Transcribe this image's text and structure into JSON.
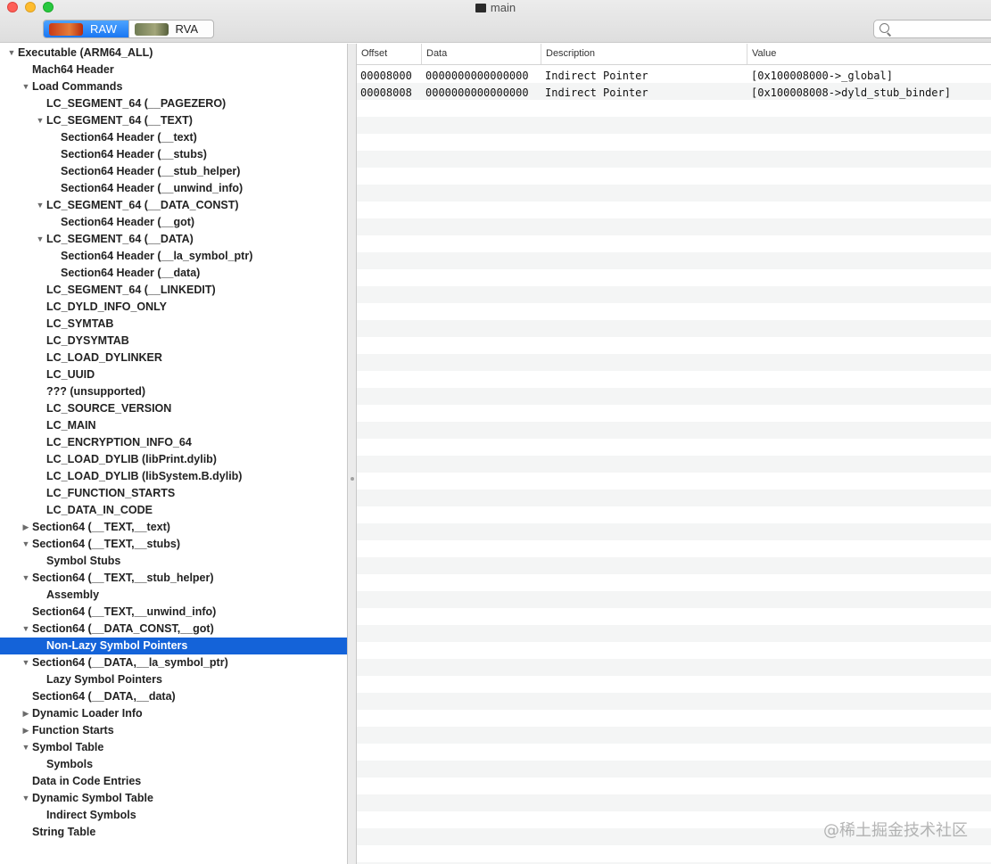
{
  "window": {
    "title": "main"
  },
  "toolbar": {
    "raw_label": "RAW",
    "rva_label": "RVA",
    "search_placeholder": ""
  },
  "tree": [
    {
      "label": "Executable  (ARM64_ALL)",
      "level": 0,
      "disclosure": "open"
    },
    {
      "label": "Mach64 Header",
      "level": 1,
      "disclosure": "none"
    },
    {
      "label": "Load Commands",
      "level": 1,
      "disclosure": "open"
    },
    {
      "label": "LC_SEGMENT_64 (__PAGEZERO)",
      "level": 2,
      "disclosure": "none"
    },
    {
      "label": "LC_SEGMENT_64 (__TEXT)",
      "level": 2,
      "disclosure": "open"
    },
    {
      "label": "Section64 Header (__text)",
      "level": 3,
      "disclosure": "none"
    },
    {
      "label": "Section64 Header (__stubs)",
      "level": 3,
      "disclosure": "none"
    },
    {
      "label": "Section64 Header (__stub_helper)",
      "level": 3,
      "disclosure": "none"
    },
    {
      "label": "Section64 Header (__unwind_info)",
      "level": 3,
      "disclosure": "none"
    },
    {
      "label": "LC_SEGMENT_64 (__DATA_CONST)",
      "level": 2,
      "disclosure": "open"
    },
    {
      "label": "Section64 Header (__got)",
      "level": 3,
      "disclosure": "none"
    },
    {
      "label": "LC_SEGMENT_64 (__DATA)",
      "level": 2,
      "disclosure": "open"
    },
    {
      "label": "Section64 Header (__la_symbol_ptr)",
      "level": 3,
      "disclosure": "none"
    },
    {
      "label": "Section64 Header (__data)",
      "level": 3,
      "disclosure": "none"
    },
    {
      "label": "LC_SEGMENT_64 (__LINKEDIT)",
      "level": 2,
      "disclosure": "none"
    },
    {
      "label": "LC_DYLD_INFO_ONLY",
      "level": 2,
      "disclosure": "none"
    },
    {
      "label": "LC_SYMTAB",
      "level": 2,
      "disclosure": "none"
    },
    {
      "label": "LC_DYSYMTAB",
      "level": 2,
      "disclosure": "none"
    },
    {
      "label": "LC_LOAD_DYLINKER",
      "level": 2,
      "disclosure": "none"
    },
    {
      "label": "LC_UUID",
      "level": 2,
      "disclosure": "none"
    },
    {
      "label": "??? (unsupported)",
      "level": 2,
      "disclosure": "none"
    },
    {
      "label": "LC_SOURCE_VERSION",
      "level": 2,
      "disclosure": "none"
    },
    {
      "label": "LC_MAIN",
      "level": 2,
      "disclosure": "none"
    },
    {
      "label": "LC_ENCRYPTION_INFO_64",
      "level": 2,
      "disclosure": "none"
    },
    {
      "label": "LC_LOAD_DYLIB (libPrint.dylib)",
      "level": 2,
      "disclosure": "none"
    },
    {
      "label": "LC_LOAD_DYLIB (libSystem.B.dylib)",
      "level": 2,
      "disclosure": "none"
    },
    {
      "label": "LC_FUNCTION_STARTS",
      "level": 2,
      "disclosure": "none"
    },
    {
      "label": "LC_DATA_IN_CODE",
      "level": 2,
      "disclosure": "none"
    },
    {
      "label": "Section64 (__TEXT,__text)",
      "level": 1,
      "disclosure": "closed"
    },
    {
      "label": "Section64 (__TEXT,__stubs)",
      "level": 1,
      "disclosure": "open"
    },
    {
      "label": "Symbol Stubs",
      "level": 2,
      "disclosure": "none"
    },
    {
      "label": "Section64 (__TEXT,__stub_helper)",
      "level": 1,
      "disclosure": "open"
    },
    {
      "label": "Assembly",
      "level": 2,
      "disclosure": "none"
    },
    {
      "label": "Section64 (__TEXT,__unwind_info)",
      "level": 1,
      "disclosure": "none"
    },
    {
      "label": "Section64 (__DATA_CONST,__got)",
      "level": 1,
      "disclosure": "open"
    },
    {
      "label": "Non-Lazy Symbol Pointers",
      "level": 2,
      "disclosure": "none",
      "selected": true
    },
    {
      "label": "Section64 (__DATA,__la_symbol_ptr)",
      "level": 1,
      "disclosure": "open"
    },
    {
      "label": "Lazy Symbol Pointers",
      "level": 2,
      "disclosure": "none"
    },
    {
      "label": "Section64 (__DATA,__data)",
      "level": 1,
      "disclosure": "none"
    },
    {
      "label": "Dynamic Loader Info",
      "level": 1,
      "disclosure": "closed"
    },
    {
      "label": "Function Starts",
      "level": 1,
      "disclosure": "closed"
    },
    {
      "label": "Symbol Table",
      "level": 1,
      "disclosure": "open"
    },
    {
      "label": "Symbols",
      "level": 2,
      "disclosure": "none"
    },
    {
      "label": "Data in Code Entries",
      "level": 1,
      "disclosure": "none"
    },
    {
      "label": "Dynamic Symbol Table",
      "level": 1,
      "disclosure": "open"
    },
    {
      "label": "Indirect Symbols",
      "level": 2,
      "disclosure": "none"
    },
    {
      "label": "String Table",
      "level": 1,
      "disclosure": "none"
    }
  ],
  "table": {
    "columns": [
      "Offset",
      "Data",
      "Description",
      "Value"
    ],
    "rows": [
      [
        "00008000",
        "0000000000000000",
        "Indirect Pointer",
        "[0x100008000->_global]"
      ],
      [
        "00008008",
        "0000000000000000",
        "Indirect Pointer",
        "[0x100008008->dyld_stub_binder]"
      ]
    ]
  },
  "watermark": "@稀土掘金技术社区"
}
